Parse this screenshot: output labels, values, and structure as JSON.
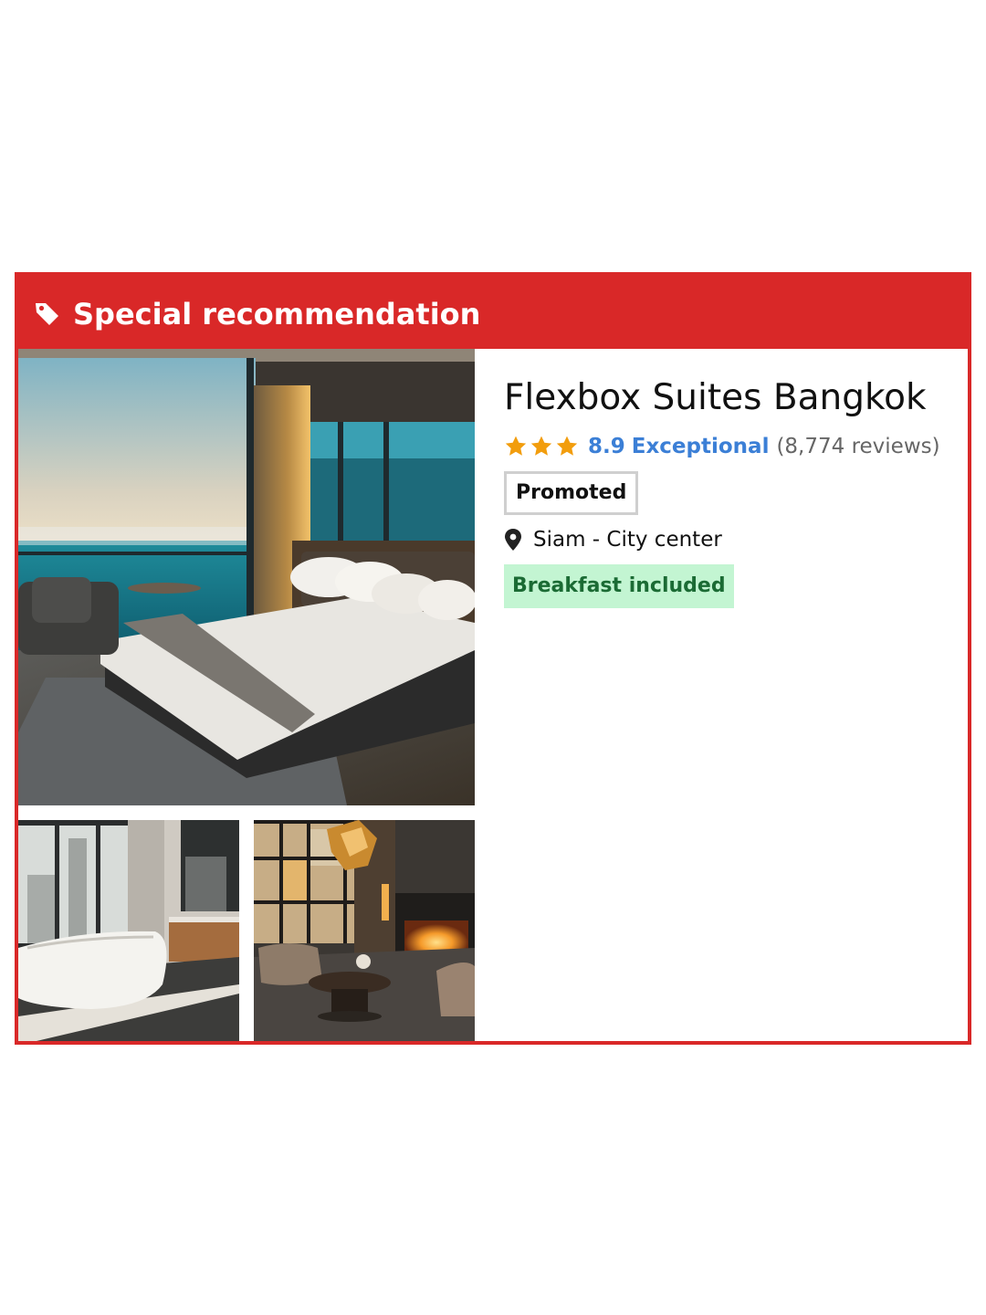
{
  "banner": {
    "icon": "tag-icon",
    "title": "Special recommendation",
    "color": "#d92828"
  },
  "photos": [
    {
      "icon": "hotel-bedroom-photo"
    },
    {
      "icon": "hotel-bathroom-photo"
    },
    {
      "icon": "hotel-lounge-photo"
    }
  ],
  "hotel": {
    "name": "Flexbox Suites Bangkok",
    "star_count": 3,
    "star_color": "#f29d0d",
    "score": "8.9",
    "rating_word": "Exceptional",
    "reviews": "(8,774 reviews)",
    "promoted_label": "Promoted",
    "location": "Siam - City center",
    "perk": "Breakfast included",
    "accent_color": "#3b7fd6",
    "perk_bg": "#c3f5d2",
    "perk_color": "#1b6b34"
  }
}
